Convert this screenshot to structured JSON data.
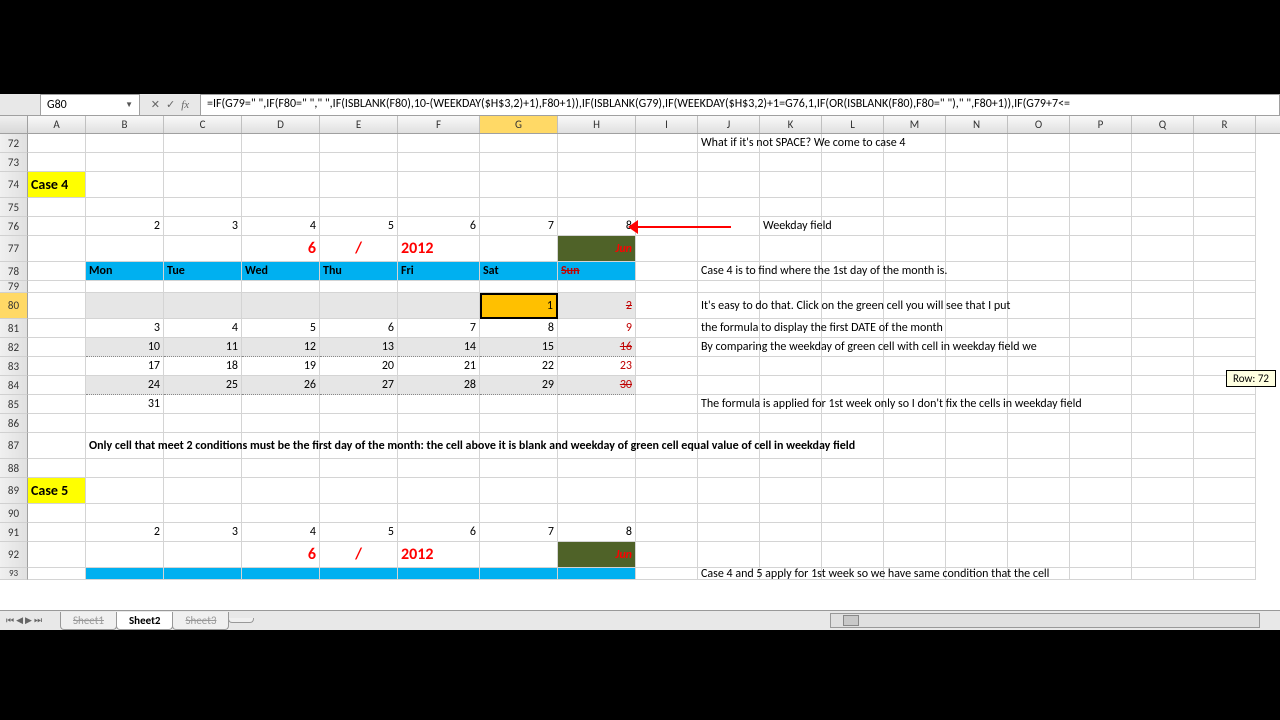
{
  "nameBox": "G80",
  "formula": "=IF(G79=\" \",IF(F80=\" \",\" \",IF(ISBLANK(F80),10-(WEEKDAY($H$3,2)+1),F80+1)),IF(ISBLANK(G79),IF(WEEKDAY($H$3,2)+1=G76,1,IF(OR(ISBLANK(F80),F80=\" \"),\" \",F80+1)),IF(G79+7<=",
  "cols": [
    "A",
    "B",
    "C",
    "D",
    "E",
    "F",
    "G",
    "H",
    "I",
    "J",
    "K",
    "L",
    "M",
    "N",
    "O",
    "P",
    "Q",
    "R"
  ],
  "rowNums": [
    "72",
    "73",
    "74",
    "75",
    "76",
    "77",
    "78",
    "79",
    "80",
    "81",
    "82",
    "83",
    "84",
    "85",
    "86",
    "87",
    "88",
    "89",
    "90",
    "91",
    "92",
    "93"
  ],
  "selCol": "G",
  "selRow": "80",
  "case4": "Case 4",
  "case5": "Case 5",
  "weekdayNums": [
    "2",
    "3",
    "4",
    "5",
    "6",
    "7",
    "8"
  ],
  "month": "6",
  "slash": "/",
  "year": "2012",
  "mon": "Jun",
  "days": [
    "Mon",
    "Tue",
    "Wed",
    "Thu",
    "Fri",
    "Sat",
    "Sun"
  ],
  "cal": {
    "w1": [
      "",
      "",
      "",
      "",
      "",
      "1",
      "2"
    ],
    "w2": [
      "3",
      "4",
      "5",
      "6",
      "7",
      "8",
      "9"
    ],
    "w3": [
      "10",
      "11",
      "12",
      "13",
      "14",
      "15",
      "16"
    ],
    "w4": [
      "17",
      "18",
      "19",
      "20",
      "21",
      "22",
      "23"
    ],
    "w5": [
      "24",
      "25",
      "26",
      "27",
      "28",
      "29",
      "30"
    ],
    "w6": [
      "31",
      "",
      "",
      "",
      "",
      "",
      ""
    ]
  },
  "txt": {
    "t72": "What if it's not SPACE? We come to case 4",
    "wkfield": "Weekday field",
    "t78": "Case 4 is to find where the 1st day of the month is.",
    "t80": "It's easy to do that. Click on the green cell you will see that I put",
    "t81": "the formula to display the first DATE of the month",
    "t82": "By comparing the weekday of green cell with cell in weekday field we",
    "t85": "The formula is applied for 1st week only so I don't fix the cells in weekday field",
    "t87": "Only cell that meet 2 conditions must be the first day of the month: the cell above it is blank and weekday of green cell equal value of cell in weekday field",
    "t93": "Case 4 and 5 apply for 1st week so we have same condition that the cell"
  },
  "tooltip": "Row: 72",
  "tabs": {
    "s1": "Sheet1",
    "s2": "Sheet2",
    "s3": "Sheet3"
  }
}
